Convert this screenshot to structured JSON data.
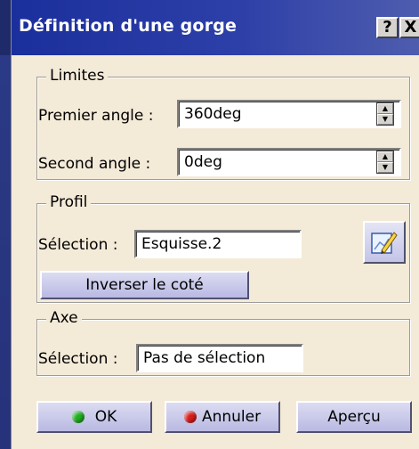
{
  "dialog": {
    "title": "Définition d'une gorge",
    "help_label": "?",
    "close_label": "X"
  },
  "limits": {
    "legend": "Limites",
    "first_angle_label": "Premier angle :",
    "first_angle_value": "360deg",
    "second_angle_label": "Second angle :",
    "second_angle_value": "0deg"
  },
  "profile": {
    "legend": "Profil",
    "selection_label": "Sélection :",
    "selection_value": "Esquisse.2",
    "reverse_label": "Inverser le coté",
    "sketch_icon": "sketch-pen-icon"
  },
  "axis": {
    "legend": "Axe",
    "selection_label": "Sélection :",
    "selection_value": "Pas de sélection"
  },
  "buttons": {
    "ok_label": "OK",
    "cancel_label": "Annuler",
    "preview_label": "Aperçu"
  },
  "colors": {
    "ok_dot": "#1fae1f",
    "cancel_dot": "#d81d1d",
    "titlebar": "#1b2f9c",
    "dialog_bg": "#f3ead8"
  }
}
